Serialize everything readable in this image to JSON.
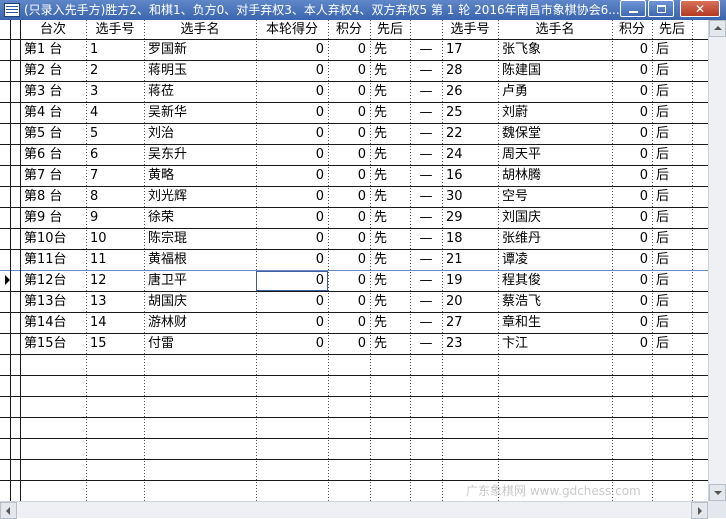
{
  "window": {
    "title": "(只录入先手方)胜方2、和棋1、负方0、对手弃权3、本人弃权4、双方弃权5  第 1 轮 2016年南昌市象棋协会6..."
  },
  "columns": [
    "台次",
    "选手号",
    "选手名",
    "本轮得分",
    "积分",
    "先后",
    "",
    "选手号",
    "选手名",
    "积分",
    "先后"
  ],
  "rows": [
    {
      "board": "第1  台",
      "no_a": "1",
      "name_a": "罗国新",
      "round_score": "0",
      "points_a": "0",
      "side_a": "先",
      "sep": "—",
      "no_b": "17",
      "name_b": "张飞象",
      "points_b": "0",
      "side_b": "后"
    },
    {
      "board": "第2  台",
      "no_a": "2",
      "name_a": "蒋明玉",
      "round_score": "0",
      "points_a": "0",
      "side_a": "先",
      "sep": "—",
      "no_b": "28",
      "name_b": "陈建国",
      "points_b": "0",
      "side_b": "后"
    },
    {
      "board": "第3  台",
      "no_a": "3",
      "name_a": "蒋莅",
      "round_score": "0",
      "points_a": "0",
      "side_a": "先",
      "sep": "—",
      "no_b": "26",
      "name_b": "卢勇",
      "points_b": "0",
      "side_b": "后"
    },
    {
      "board": "第4  台",
      "no_a": "4",
      "name_a": "吴新华",
      "round_score": "0",
      "points_a": "0",
      "side_a": "先",
      "sep": "—",
      "no_b": "25",
      "name_b": "刘蔚",
      "points_b": "0",
      "side_b": "后"
    },
    {
      "board": "第5  台",
      "no_a": "5",
      "name_a": "刘治",
      "round_score": "0",
      "points_a": "0",
      "side_a": "先",
      "sep": "—",
      "no_b": "22",
      "name_b": "魏保堂",
      "points_b": "0",
      "side_b": "后"
    },
    {
      "board": "第6  台",
      "no_a": "6",
      "name_a": "吴东升",
      "round_score": "0",
      "points_a": "0",
      "side_a": "先",
      "sep": "—",
      "no_b": "24",
      "name_b": "周天平",
      "points_b": "0",
      "side_b": "后"
    },
    {
      "board": "第7  台",
      "no_a": "7",
      "name_a": "黄略",
      "round_score": "0",
      "points_a": "0",
      "side_a": "先",
      "sep": "—",
      "no_b": "16",
      "name_b": "胡林腾",
      "points_b": "0",
      "side_b": "后"
    },
    {
      "board": "第8  台",
      "no_a": "8",
      "name_a": "刘光辉",
      "round_score": "0",
      "points_a": "0",
      "side_a": "先",
      "sep": "—",
      "no_b": "30",
      "name_b": "空号",
      "points_b": "0",
      "side_b": "后"
    },
    {
      "board": "第9  台",
      "no_a": "9",
      "name_a": "徐荣",
      "round_score": "0",
      "points_a": "0",
      "side_a": "先",
      "sep": "—",
      "no_b": "29",
      "name_b": "刘国庆",
      "points_b": "0",
      "side_b": "后"
    },
    {
      "board": "第10台",
      "no_a": "10",
      "name_a": "陈宗琨",
      "round_score": "0",
      "points_a": "0",
      "side_a": "先",
      "sep": "—",
      "no_b": "18",
      "name_b": "张维丹",
      "points_b": "0",
      "side_b": "后"
    },
    {
      "board": "第11台",
      "no_a": "11",
      "name_a": "黄福根",
      "round_score": "0",
      "points_a": "0",
      "side_a": "先",
      "sep": "—",
      "no_b": "21",
      "name_b": "谭凌",
      "points_b": "0",
      "side_b": "后"
    },
    {
      "board": "第12台",
      "no_a": "12",
      "name_a": "唐卫平",
      "round_score": "0",
      "points_a": "0",
      "side_a": "先",
      "sep": "—",
      "no_b": "19",
      "name_b": "程其俊",
      "points_b": "0",
      "side_b": "后"
    },
    {
      "board": "第13台",
      "no_a": "13",
      "name_a": "胡国庆",
      "round_score": "0",
      "points_a": "0",
      "side_a": "先",
      "sep": "—",
      "no_b": "20",
      "name_b": "蔡浩飞",
      "points_b": "0",
      "side_b": "后"
    },
    {
      "board": "第14台",
      "no_a": "14",
      "name_a": "游林财",
      "round_score": "0",
      "points_a": "0",
      "side_a": "先",
      "sep": "—",
      "no_b": "27",
      "name_b": "章和生",
      "points_b": "0",
      "side_b": "后"
    },
    {
      "board": "第15台",
      "no_a": "15",
      "name_a": "付雷",
      "round_score": "0",
      "points_a": "0",
      "side_a": "先",
      "sep": "—",
      "no_b": "23",
      "name_b": "卞江",
      "points_b": "0",
      "side_b": "后"
    }
  ],
  "selected_row": 11,
  "watermark": "广东象棋网 www.gdchess.com",
  "icons": [
    "app-icon",
    "minimize-icon",
    "maximize-icon",
    "close-icon",
    "current-row-pointer-icon",
    "scroll-up-icon",
    "scroll-down-icon",
    "scroll-left-icon",
    "scroll-right-icon"
  ],
  "colors": {
    "titlebar": "#3a64ad",
    "close": "#b53a22",
    "grid_line": "#1a1a1a",
    "focus": "#3b5ea0"
  }
}
